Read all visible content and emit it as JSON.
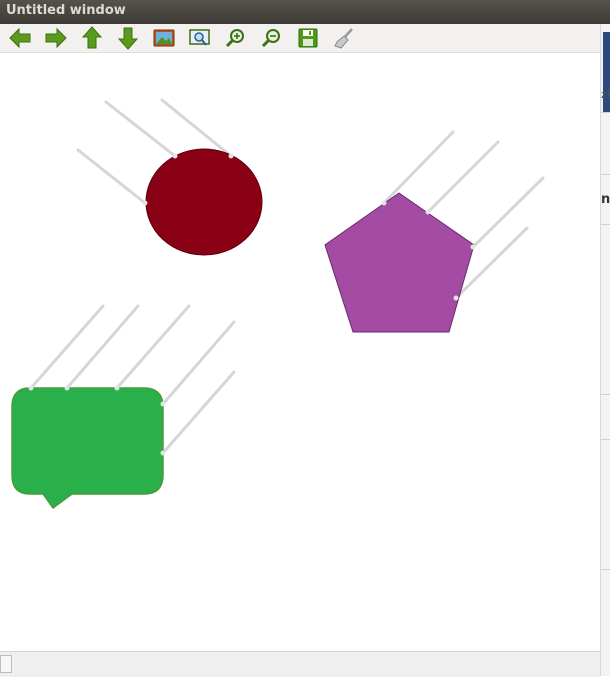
{
  "window": {
    "title": "Untitled window"
  },
  "toolbar": {
    "buttons": [
      {
        "name": "back",
        "icon": "arrow-left-icon"
      },
      {
        "name": "forward",
        "icon": "arrow-right-icon"
      },
      {
        "name": "up",
        "icon": "arrow-up-icon"
      },
      {
        "name": "down",
        "icon": "arrow-down-icon"
      },
      {
        "name": "image",
        "icon": "image-icon"
      },
      {
        "name": "zoom-fit",
        "icon": "zoom-fit-icon"
      },
      {
        "name": "zoom-in",
        "icon": "zoom-in-icon"
      },
      {
        "name": "zoom-out",
        "icon": "zoom-out-icon"
      },
      {
        "name": "save",
        "icon": "save-icon"
      },
      {
        "name": "clear",
        "icon": "broom-icon"
      }
    ]
  },
  "canvas": {
    "shapes": [
      {
        "kind": "circle",
        "color": "#8a0014"
      },
      {
        "kind": "pentagon",
        "color": "#a44ca4"
      },
      {
        "kind": "speech-bubble",
        "color": "#29b04a"
      }
    ]
  },
  "background_window": {
    "text1": "zF",
    "text2": "nt"
  }
}
